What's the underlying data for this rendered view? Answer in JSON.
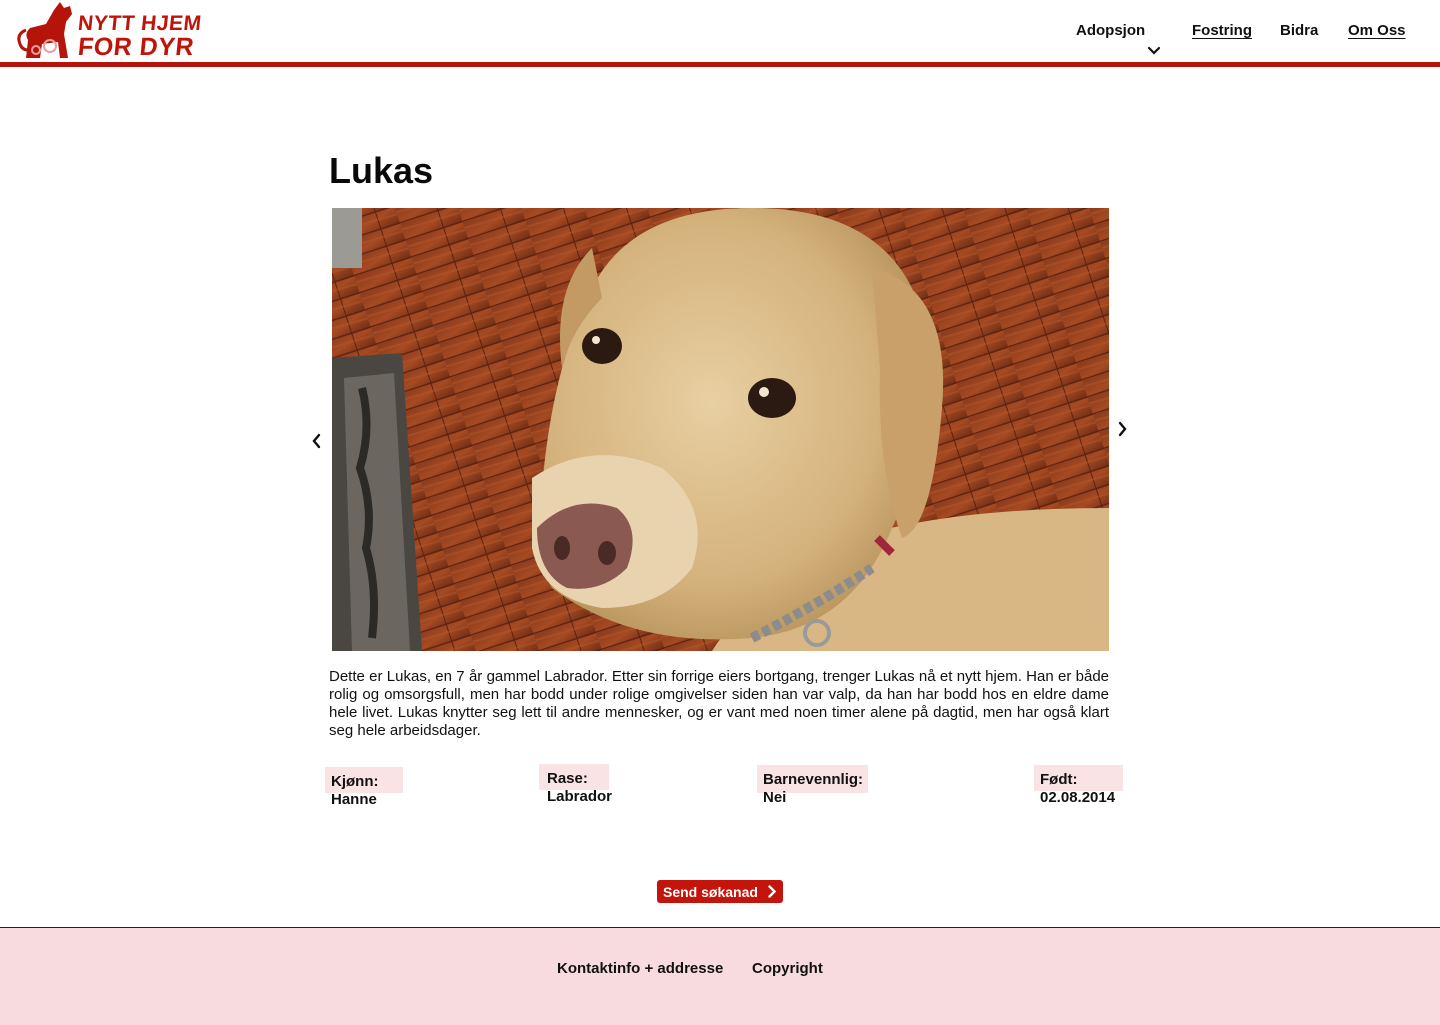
{
  "brand": {
    "logo_line1": "NYTT HJEM",
    "logo_line2": "FOR DYR",
    "color": "#c0140a"
  },
  "nav": {
    "items": [
      {
        "label": "Adopsjon",
        "has_dropdown": true
      },
      {
        "label": "Fostring"
      },
      {
        "label": "Bidra"
      },
      {
        "label": "Om Oss"
      }
    ]
  },
  "animal": {
    "name": "Lukas",
    "description": "Dette er Lukas, en 7 år gammel Labrador. Etter sin forrige eiers bortgang, trenger Lukas nå et nytt hjem. Han er både rolig og omsorgsfull, men har bodd under rolige omgivelser siden han var valp, da han har bodd hos en eldre dame hele livet. Lukas knytter seg lett til andre mennesker, og er vant med noen timer alene på dagtid, men har også klart seg hele arbeidsdager.",
    "photo_icon": "dog-photo",
    "info": [
      {
        "label": "Kjønn:",
        "value": "Hanne"
      },
      {
        "label": "Rase:",
        "value": "Labrador"
      },
      {
        "label": "Barnevennlig:",
        "value": "Nei"
      },
      {
        "label": "Født:",
        "value": "02.08.2014"
      }
    ]
  },
  "gallery": {
    "prev_icon": "chevron-left-icon",
    "next_icon": "chevron-right-icon"
  },
  "apply_button": {
    "label": "Send søkanad",
    "color": "#c4150c"
  },
  "footer": {
    "links": [
      "Kontaktinfo + addresse",
      "Copyright"
    ],
    "background": "#f8dbdf"
  }
}
